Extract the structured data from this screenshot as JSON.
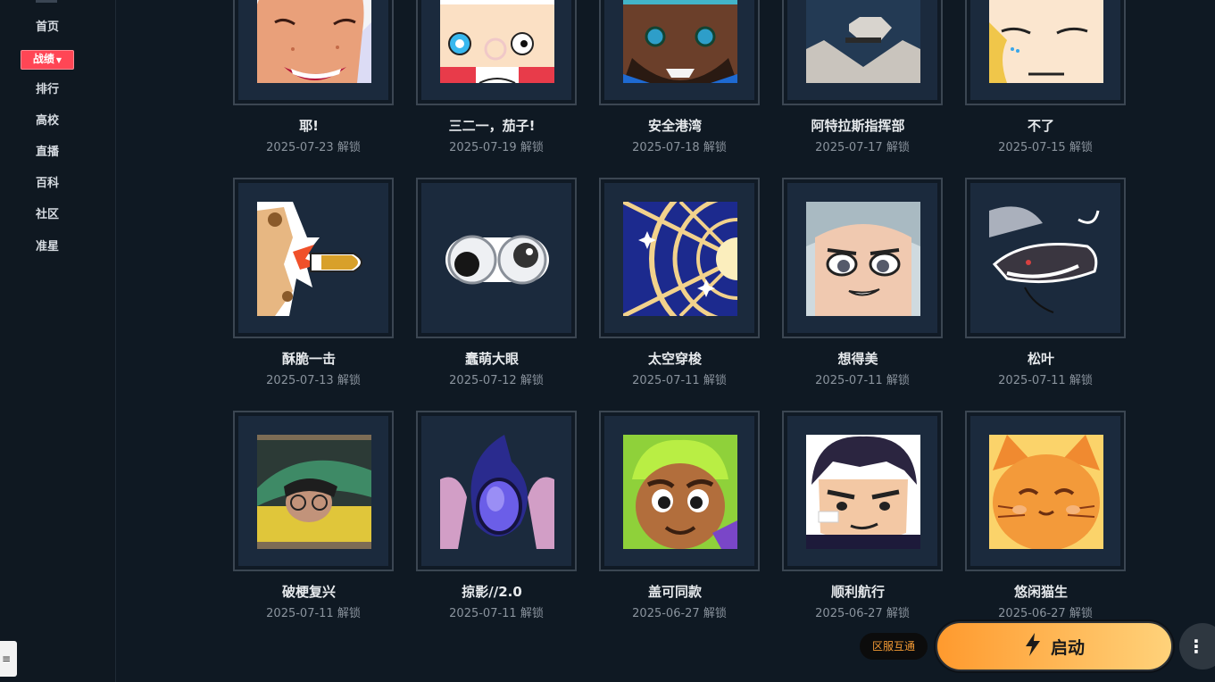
{
  "sidebar": {
    "items": [
      {
        "label": "首页"
      },
      {
        "label": "战绩",
        "active": true
      },
      {
        "label": "排行"
      },
      {
        "label": "高校"
      },
      {
        "label": "直播"
      },
      {
        "label": "百科"
      },
      {
        "label": "社区"
      },
      {
        "label": "准星"
      }
    ],
    "drawer_tab_glyph": "≡"
  },
  "cards": [
    {
      "title": "耶!",
      "date": "2025-07-23 解锁"
    },
    {
      "title": "三二一，茄子!",
      "date": "2025-07-19 解锁"
    },
    {
      "title": "安全港湾",
      "date": "2025-07-18 解锁"
    },
    {
      "title": "阿特拉斯指挥部",
      "date": "2025-07-17 解锁"
    },
    {
      "title": "不了",
      "date": "2025-07-15 解锁"
    },
    {
      "title": "酥脆一击",
      "date": "2025-07-13 解锁"
    },
    {
      "title": "蠢萌大眼",
      "date": "2025-07-12 解锁"
    },
    {
      "title": "太空穿梭",
      "date": "2025-07-11 解锁"
    },
    {
      "title": "想得美",
      "date": "2025-07-11 解锁"
    },
    {
      "title": "松叶",
      "date": "2025-07-11 解锁"
    },
    {
      "title": "破梗复兴",
      "date": "2025-07-11 解锁"
    },
    {
      "title": "掠影//2.0",
      "date": "2025-07-11 解锁"
    },
    {
      "title": "盖可同款",
      "date": "2025-06-27 解锁"
    },
    {
      "title": "顺利航行",
      "date": "2025-06-27 解锁"
    },
    {
      "title": "悠闲猫生",
      "date": "2025-06-27 解锁"
    }
  ],
  "footer": {
    "region_badge": "区服互通",
    "launch_label": "启动",
    "more_glyph": "⋮"
  },
  "colors": {
    "background": "#0f1923",
    "accent_red": "#ff4655",
    "launch_gradient_start": "#ff9a2e",
    "launch_gradient_end": "#ffd27a"
  }
}
